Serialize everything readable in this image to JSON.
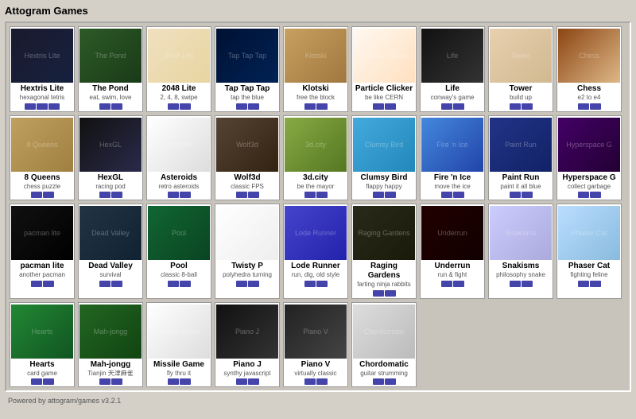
{
  "app": {
    "title": "Attogram Games",
    "footer": "Powered by attogram/games v3.2.1"
  },
  "games": [
    {
      "id": "hextris-lite",
      "title": "Hextris Lite",
      "subtitle": "hexagonal tetris",
      "thumb": "thumb-hextris",
      "platforms": [
        "blue",
        "blue",
        "blue"
      ]
    },
    {
      "id": "the-pond",
      "title": "The Pond",
      "subtitle": "eat, swim, love",
      "thumb": "thumb-pond",
      "platforms": [
        "blue",
        "blue"
      ]
    },
    {
      "id": "2048-lite",
      "title": "2048 Lite",
      "subtitle": "2, 4, 8, swipe",
      "thumb": "thumb-2048",
      "platforms": [
        "blue",
        "blue"
      ]
    },
    {
      "id": "tap-tap-tap",
      "title": "Tap Tap Tap",
      "subtitle": "tap the blue",
      "thumb": "thumb-taptap",
      "platforms": [
        "blue",
        "blue"
      ]
    },
    {
      "id": "klotski",
      "title": "Klotski",
      "subtitle": "free the block",
      "thumb": "thumb-klotski",
      "platforms": [
        "blue",
        "blue"
      ]
    },
    {
      "id": "particle-clicker",
      "title": "Particle Clicker",
      "subtitle": "be like CERN",
      "thumb": "thumb-particle",
      "platforms": [
        "blue",
        "blue"
      ]
    },
    {
      "id": "life",
      "title": "Life",
      "subtitle": "conway's game",
      "thumb": "thumb-life",
      "platforms": [
        "blue",
        "blue"
      ]
    },
    {
      "id": "tower",
      "title": "Tower",
      "subtitle": "build up",
      "thumb": "thumb-tower",
      "platforms": [
        "blue",
        "blue"
      ]
    },
    {
      "id": "chess",
      "title": "Chess",
      "subtitle": "e2 to e4",
      "thumb": "thumb-chess",
      "platforms": [
        "blue",
        "blue"
      ]
    },
    {
      "id": "8queens",
      "title": "8 Queens",
      "subtitle": "chess puzzle",
      "thumb": "thumb-8queens",
      "platforms": [
        "blue",
        "blue"
      ]
    },
    {
      "id": "hexgl",
      "title": "HexGL",
      "subtitle": "racing pod",
      "thumb": "thumb-hexgl",
      "platforms": [
        "blue",
        "blue"
      ]
    },
    {
      "id": "asteroids",
      "title": "Asteroids",
      "subtitle": "retro asteroids",
      "thumb": "thumb-asteroids",
      "platforms": [
        "blue",
        "blue"
      ]
    },
    {
      "id": "wolf3d",
      "title": "Wolf3d",
      "subtitle": "classic FPS",
      "thumb": "thumb-wolf3d",
      "platforms": [
        "blue",
        "blue"
      ]
    },
    {
      "id": "3dcity",
      "title": "3d.city",
      "subtitle": "be the mayor",
      "thumb": "thumb-3dcity",
      "platforms": [
        "blue",
        "blue"
      ]
    },
    {
      "id": "clumsy-bird",
      "title": "Clumsy Bird",
      "subtitle": "flappy happy",
      "thumb": "thumb-clumsybird",
      "platforms": [
        "blue",
        "blue"
      ]
    },
    {
      "id": "fire-n-ice",
      "title": "Fire 'n Ice",
      "subtitle": "move the ice",
      "thumb": "thumb-firenice",
      "platforms": [
        "blue",
        "blue"
      ]
    },
    {
      "id": "paint-run",
      "title": "Paint Run",
      "subtitle": "paint it all blue",
      "thumb": "thumb-paintrun",
      "platforms": [
        "blue",
        "blue"
      ]
    },
    {
      "id": "hyperspace-g",
      "title": "Hyperspace G",
      "subtitle": "collect garbage",
      "thumb": "thumb-hyperspace",
      "platforms": [
        "blue",
        "blue"
      ]
    },
    {
      "id": "pacman-lite",
      "title": "pacman lite",
      "subtitle": "another pacman",
      "thumb": "thumb-pacman",
      "platforms": [
        "blue",
        "blue"
      ]
    },
    {
      "id": "dead-valley",
      "title": "Dead Valley",
      "subtitle": "survival",
      "thumb": "thumb-deadvalley",
      "platforms": [
        "blue",
        "blue"
      ]
    },
    {
      "id": "pool",
      "title": "Pool",
      "subtitle": "classic 8-ball",
      "thumb": "thumb-pool",
      "platforms": [
        "blue",
        "blue"
      ]
    },
    {
      "id": "twisty-p",
      "title": "Twisty P",
      "subtitle": "polyhedra turning",
      "thumb": "thumb-twistyp",
      "platforms": [
        "blue",
        "blue"
      ]
    },
    {
      "id": "lode-runner",
      "title": "Lode Runner",
      "subtitle": "run, dig, old style",
      "thumb": "thumb-loderunner",
      "platforms": [
        "blue",
        "blue"
      ]
    },
    {
      "id": "raging-gardens",
      "title": "Raging Gardens",
      "subtitle": "farting ninja rabbits",
      "thumb": "thumb-raging",
      "platforms": [
        "blue",
        "blue"
      ]
    },
    {
      "id": "underrun",
      "title": "Underrun",
      "subtitle": "run & fight",
      "thumb": "thumb-underrun",
      "platforms": [
        "blue",
        "blue"
      ]
    },
    {
      "id": "snakisms",
      "title": "Snakisms",
      "subtitle": "philosophy snake",
      "thumb": "thumb-snakisms",
      "platforms": [
        "blue",
        "blue"
      ]
    },
    {
      "id": "phaser-cat",
      "title": "Phaser Cat",
      "subtitle": "fighting feline",
      "thumb": "thumb-phasercat",
      "platforms": [
        "blue",
        "blue"
      ]
    },
    {
      "id": "hearts",
      "title": "Hearts",
      "subtitle": "card game",
      "thumb": "thumb-hearts",
      "platforms": [
        "blue",
        "blue"
      ]
    },
    {
      "id": "mah-jongg",
      "title": "Mah-jongg",
      "subtitle": "Tianjin 天津麻雀",
      "thumb": "thumb-mahjongg",
      "platforms": [
        "blue",
        "blue"
      ]
    },
    {
      "id": "missile-game",
      "title": "Missile Game",
      "subtitle": "fly thru it",
      "thumb": "thumb-missile",
      "platforms": [
        "blue",
        "blue"
      ]
    },
    {
      "id": "piano-j",
      "title": "Piano J",
      "subtitle": "synthy javascript",
      "thumb": "thumb-pianoj",
      "platforms": [
        "blue",
        "blue"
      ]
    },
    {
      "id": "piano-v",
      "title": "Piano V",
      "subtitle": "virtually classic",
      "thumb": "thumb-pianv",
      "platforms": [
        "blue",
        "blue"
      ]
    },
    {
      "id": "chordomatic",
      "title": "Chordomatic",
      "subtitle": "guitar strumming",
      "thumb": "thumb-chordo",
      "platforms": [
        "blue",
        "blue"
      ]
    }
  ]
}
